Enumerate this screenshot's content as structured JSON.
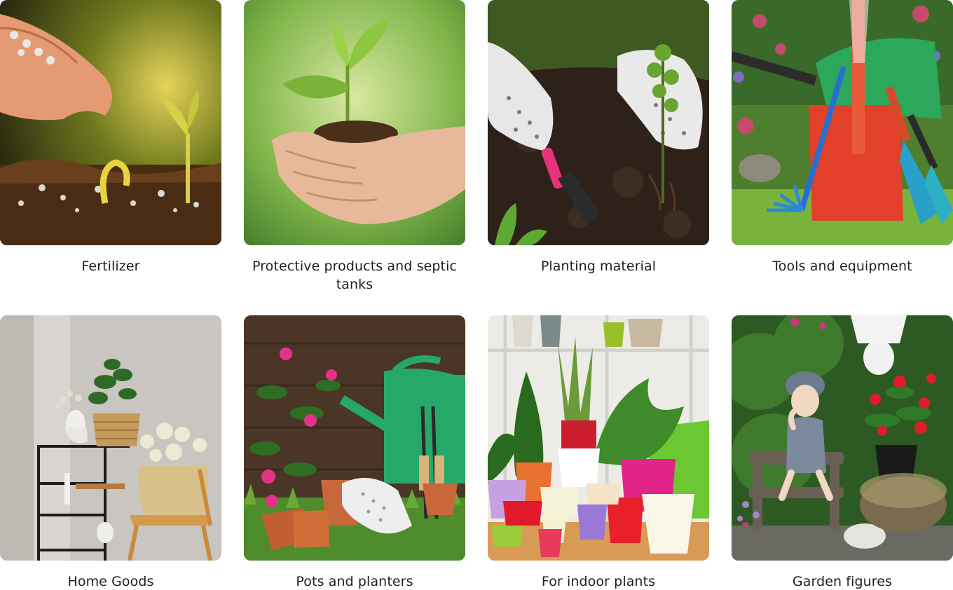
{
  "categories": [
    {
      "label": "Fertilizer",
      "image": "fertilizer-photo"
    },
    {
      "label": "Protective products and septic tanks",
      "image": "seedling-in-hands-photo"
    },
    {
      "label": "Planting material",
      "image": "planting-seedling-photo"
    },
    {
      "label": "Tools and equipment",
      "image": "garden-tools-photo"
    },
    {
      "label": "Home Goods",
      "image": "home-decor-shelf-photo"
    },
    {
      "label": "Pots and planters",
      "image": "pots-watering-can-photo"
    },
    {
      "label": "For indoor plants",
      "image": "indoor-plant-pots-photo"
    },
    {
      "label": "Garden figures",
      "image": "garden-figurine-photo"
    }
  ],
  "colors": {
    "label_text": "#1e1e1e",
    "background": "#ffffff"
  }
}
